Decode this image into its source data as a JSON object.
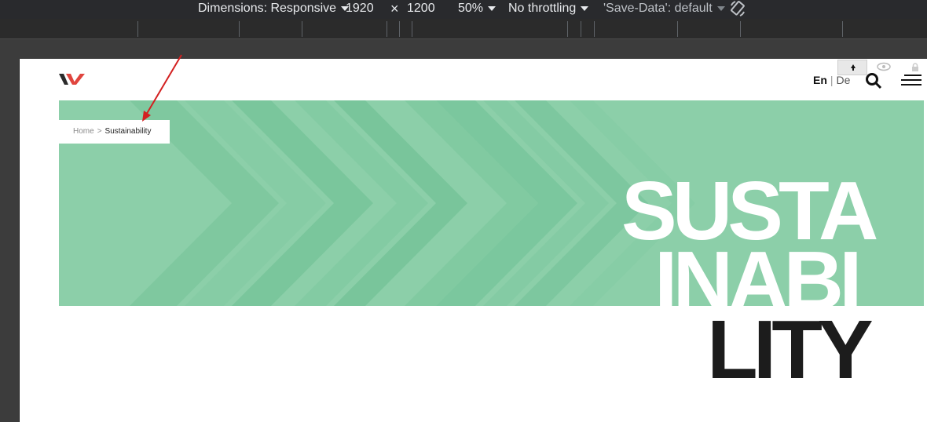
{
  "devtools": {
    "dimensions_label": "Dimensions: Responsive",
    "width": "1920",
    "times": "×",
    "height": "1200",
    "zoom": "50%",
    "throttling": "No throttling",
    "save_data": "'Save-Data': default"
  },
  "header": {
    "lang_en": "En",
    "lang_sep": "|",
    "lang_de": "De"
  },
  "breadcrumb": {
    "home": "Home",
    "separator": ">",
    "current": "Sustainability"
  },
  "hero": {
    "line1": "SUSTA",
    "line2": "INABI",
    "line3": "LITY",
    "background": "#8ccfa9"
  },
  "colors": {
    "accent_red": "#e0453e",
    "logo_dark": "#2b2b2b",
    "annotation": "#d32020"
  }
}
